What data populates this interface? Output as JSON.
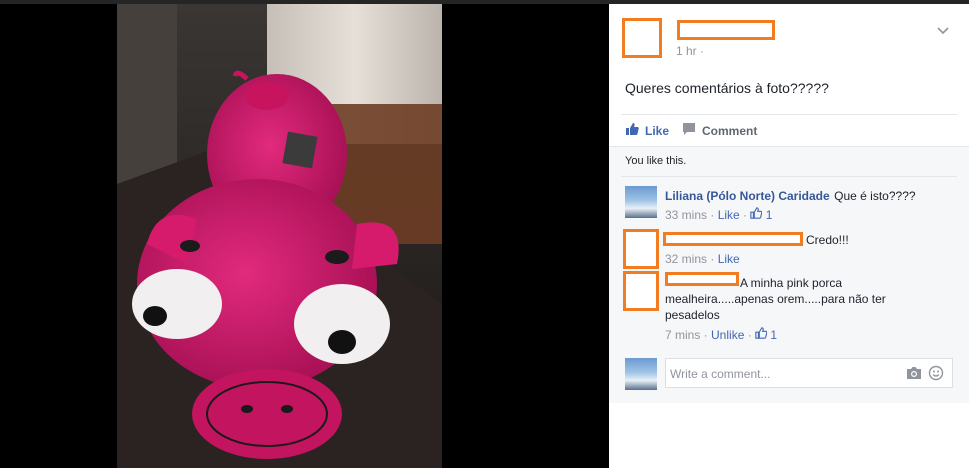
{
  "post": {
    "time": "1 hr",
    "privacy_sep": "·",
    "text": "Queres comentários à foto?????",
    "like_label": "Like",
    "comment_label": "Comment",
    "you_like": "You like this."
  },
  "comments": [
    {
      "name": "Liliana (Pólo Norte) Caridade",
      "text": "Que é isto????",
      "time": "33 mins",
      "action": "Like",
      "likes": "1"
    },
    {
      "name": "",
      "text": "Credo!!!",
      "time": "32 mins",
      "action": "Like",
      "likes": ""
    },
    {
      "name": "",
      "text": "A minha pink porca mealheira.....apenas orem.....para não ter pesadelos",
      "time": "7 mins",
      "action": "Unlike",
      "likes": "1"
    }
  ],
  "composer": {
    "placeholder": "Write a comment..."
  },
  "icons": {
    "menu": "chevron-down-icon",
    "like": "thumbs-up-icon",
    "comment": "speech-bubble-icon",
    "camera": "camera-icon",
    "emoji": "smiley-icon"
  },
  "colors": {
    "fb_blue": "#4267b2",
    "name_blue": "#365899",
    "redaction_orange": "#f47c20",
    "toy_pink": "#d7186c"
  }
}
